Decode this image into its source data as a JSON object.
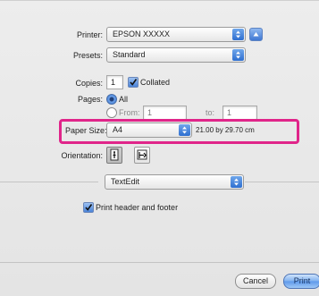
{
  "printer": {
    "label": "Printer:",
    "value": "EPSON XXXXX"
  },
  "presets": {
    "label": "Presets:",
    "value": "Standard"
  },
  "copies": {
    "label": "Copies:",
    "value": "1",
    "collated_label": "Collated",
    "collated": true
  },
  "pages": {
    "label": "Pages:",
    "all_label": "All",
    "from_label": "From:",
    "from_value": "1",
    "to_label": "to:",
    "to_value": "1",
    "selected": "all"
  },
  "paper_size": {
    "label": "Paper Size:",
    "value": "A4",
    "dimensions": "21.00 by 29.70 cm"
  },
  "orientation": {
    "label": "Orientation:",
    "selected": "portrait"
  },
  "section": {
    "value": "TextEdit"
  },
  "header_footer": {
    "label": "Print header and footer",
    "checked": true
  },
  "buttons": {
    "cancel": "Cancel",
    "print": "Print"
  },
  "colors": {
    "highlight": "#e0258a",
    "accent": "#3f78d3"
  },
  "icons": {
    "popup": "up-down-arrows-icon",
    "checkbox": "checkmark-icon",
    "portrait": "portrait-orientation-icon",
    "landscape": "landscape-orientation-icon",
    "disclosure": "triangle-up-icon"
  }
}
